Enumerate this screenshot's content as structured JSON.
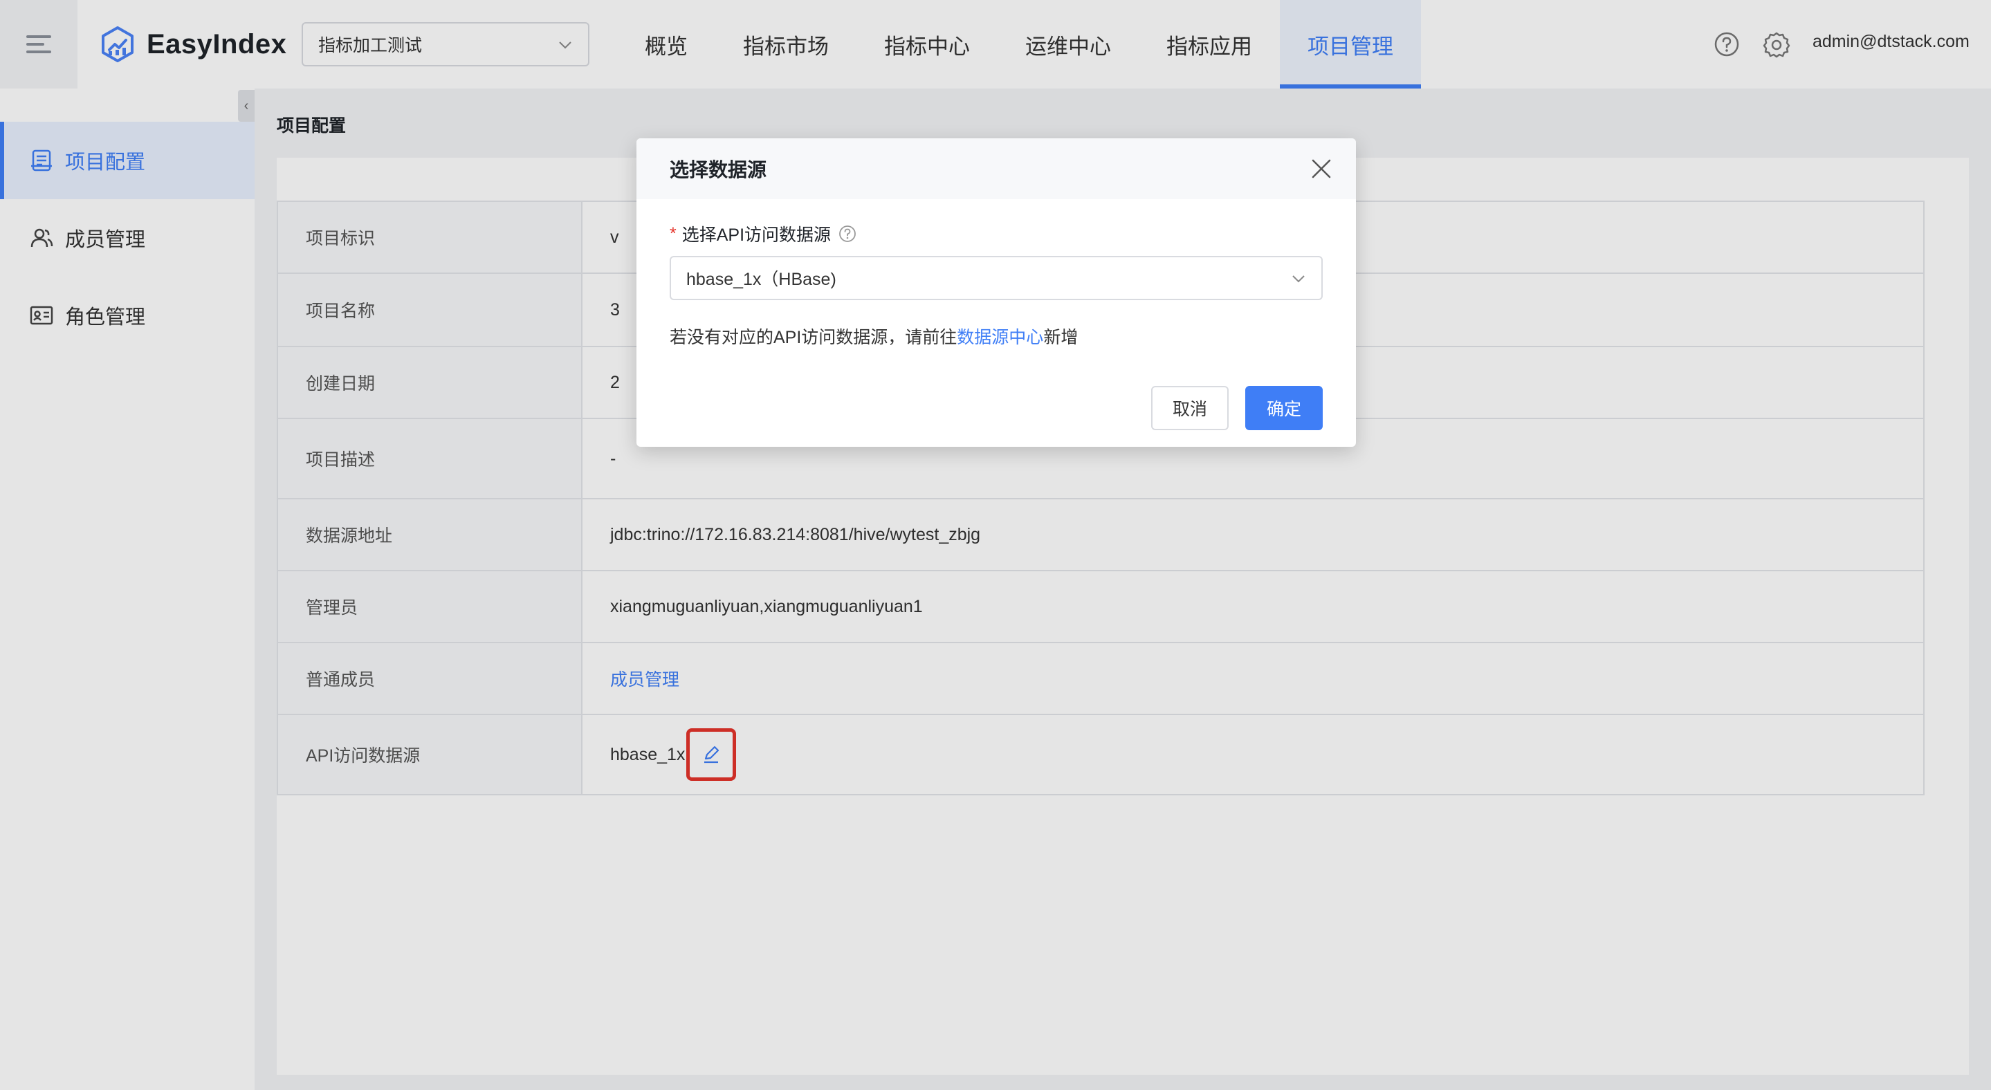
{
  "header": {
    "app_name": "EasyIndex",
    "project_select": "指标加工测试",
    "nav": [
      "概览",
      "指标市场",
      "指标中心",
      "运维中心",
      "指标应用",
      "项目管理"
    ],
    "active_nav_index": 5,
    "user": "admin@dtstack.com"
  },
  "sidebar": {
    "collapse_glyph": "‹",
    "items": [
      {
        "label": "项目配置",
        "icon": "config-icon",
        "active": true
      },
      {
        "label": "成员管理",
        "icon": "users-icon",
        "active": false
      },
      {
        "label": "角色管理",
        "icon": "id-card-icon",
        "active": false
      }
    ]
  },
  "main": {
    "page_title": "项目配置",
    "rows": [
      {
        "label": "项目标识",
        "value": "v"
      },
      {
        "label": "项目名称",
        "value": "3"
      },
      {
        "label": "创建日期",
        "value": "2"
      },
      {
        "label": "项目描述",
        "value": "-"
      },
      {
        "label": "数据源地址",
        "value": "jdbc:trino://172.16.83.214:8081/hive/wytest_zbjg"
      },
      {
        "label": "管理员",
        "value": "xiangmuguanliyuan,xiangmuguanliyuan1"
      },
      {
        "label": "普通成员",
        "value": "成员管理"
      },
      {
        "label": "API访问数据源",
        "value": "hbase_1x"
      }
    ]
  },
  "modal": {
    "title": "选择数据源",
    "required_mark": "*",
    "field_label": "选择API访问数据源",
    "selected_value": "hbase_1x（HBase)",
    "hint_prefix": "若没有对应的API访问数据源，请前往",
    "hint_link": "数据源中心",
    "hint_suffix": "新增",
    "cancel_label": "取消",
    "ok_label": "确定"
  },
  "colors": {
    "accent": "#3f7ef6",
    "highlight_border": "#e5342b"
  }
}
